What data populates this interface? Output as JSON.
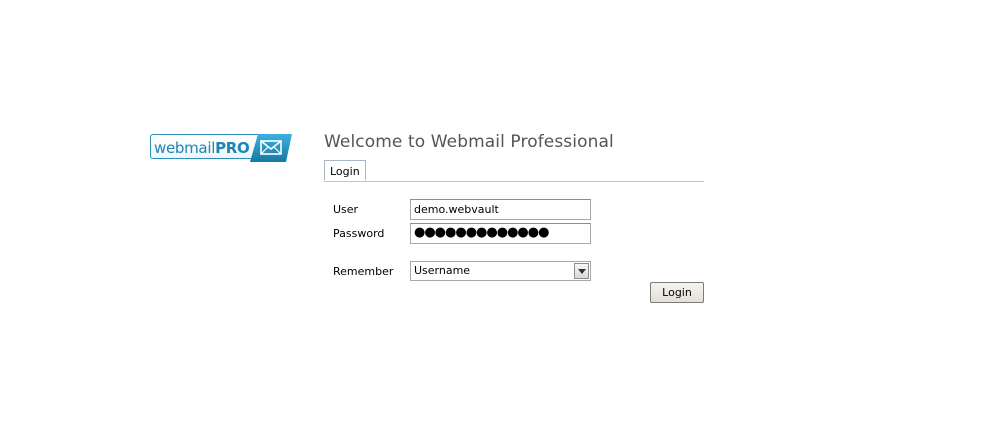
{
  "logo": {
    "text_webmail": "webmail",
    "text_pro": "PRO",
    "icon": "envelope-icon",
    "brand_color": "#1e85b2"
  },
  "header": {
    "title": "Welcome to Webmail Professional"
  },
  "tabs": [
    {
      "label": "Login",
      "active": true
    }
  ],
  "form": {
    "user_label": "User",
    "user_value": "demo.webvault",
    "password_label": "Password",
    "password_value": "●●●●●●●●●●●●●",
    "remember_label": "Remember",
    "remember_selected": "Username",
    "login_button": "Login"
  }
}
